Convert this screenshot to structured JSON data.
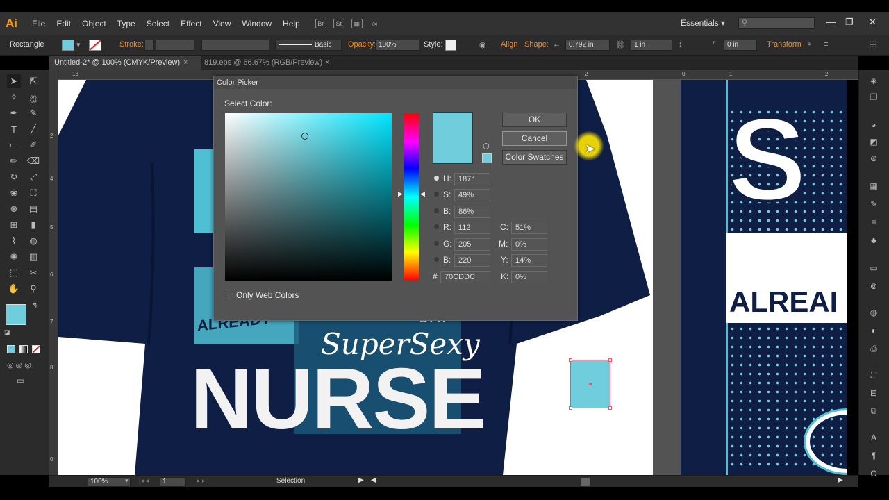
{
  "app": {
    "logo": "Ai",
    "menu": [
      "File",
      "Edit",
      "Object",
      "Type",
      "Select",
      "Effect",
      "View",
      "Window",
      "Help"
    ],
    "workspace": "Essentials",
    "window_controls": [
      "minimize",
      "restore",
      "close"
    ]
  },
  "control_bar": {
    "object_type": "Rectangle",
    "stroke_label": "Stroke:",
    "stroke_profile": "Basic",
    "opacity_label": "Opacity:",
    "opacity_value": "100%",
    "style_label": "Style:",
    "align_label": "Align",
    "shape_label": "Shape:",
    "width_value": "0.792 in",
    "height_value": "1 in",
    "corner_value": "0 in",
    "transform_label": "Transform"
  },
  "tabs": [
    {
      "label": "Untitled-2* @ 100% (CMYK/Preview)",
      "active": true
    },
    {
      "label": "819.eps @ 66.67% (RGB/Preview)",
      "active": false
    }
  ],
  "rulers": {
    "top": [
      "13",
      "0",
      "1",
      "2",
      "3",
      "0",
      "1",
      "2"
    ],
    "left": [
      "2",
      "3",
      "4",
      "5",
      "6",
      "7",
      "8",
      "9",
      "0"
    ]
  },
  "artwork": {
    "shirt_text_main": "NURSE",
    "shirt_text_script": "SuperSexy",
    "shirt_text_small": "BY A",
    "shirt_text_already": "ALREADY",
    "right_text_big": "S",
    "right_text_already": "ALREAI",
    "shirt_color": "#0f1e44",
    "selected_rect_fill": "#70cddc"
  },
  "color_picker": {
    "title": "Color Picker",
    "select_label": "Select Color:",
    "ok_label": "OK",
    "cancel_label": "Cancel",
    "swatches_label": "Color Swatches",
    "only_web_label": "Only Web Colors",
    "current_color": "#70cddc",
    "fields": {
      "H": "187°",
      "S": "49%",
      "B": "86%",
      "R": "112",
      "G": "205",
      "Bv": "220",
      "hex": "70CDDC",
      "C": "51%",
      "M": "0%",
      "Y": "14%",
      "K": "0%"
    },
    "labels": {
      "H": "H:",
      "S": "S:",
      "B": "B:",
      "R": "R:",
      "G": "G:",
      "Bv": "B:",
      "hash": "#",
      "C": "C:",
      "M": "M:",
      "Y": "Y:",
      "K": "K:"
    }
  },
  "status_bar": {
    "zoom": "100%",
    "artboard": "1",
    "tool_status": "Selection"
  },
  "toolbar": {
    "fill_color": "#70cddc"
  }
}
